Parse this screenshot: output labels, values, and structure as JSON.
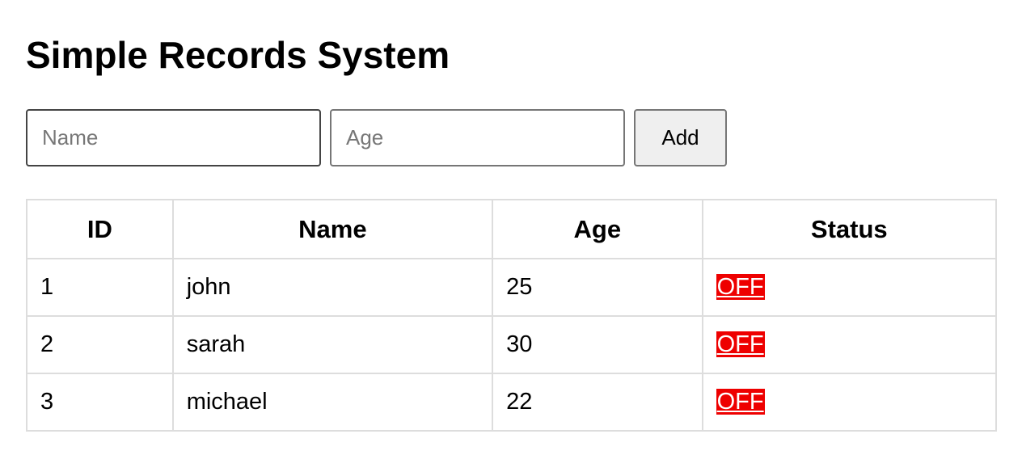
{
  "page": {
    "title": "Simple Records System"
  },
  "form": {
    "name_placeholder": "Name",
    "name_value": "",
    "age_placeholder": "Age",
    "age_value": "",
    "add_label": "Add"
  },
  "table": {
    "headers": [
      "ID",
      "Name",
      "Age",
      "Status"
    ],
    "rows": [
      {
        "id": "1",
        "name": "john",
        "age": "25",
        "status": "OFF"
      },
      {
        "id": "2",
        "name": "sarah",
        "age": "30",
        "status": "OFF"
      },
      {
        "id": "3",
        "name": "michael",
        "age": "22",
        "status": "OFF"
      }
    ]
  },
  "colors": {
    "status_off_bg": "#ee0000",
    "status_off_text": "#ffffff",
    "table_border": "#dddddd",
    "button_bg": "#efefef"
  }
}
